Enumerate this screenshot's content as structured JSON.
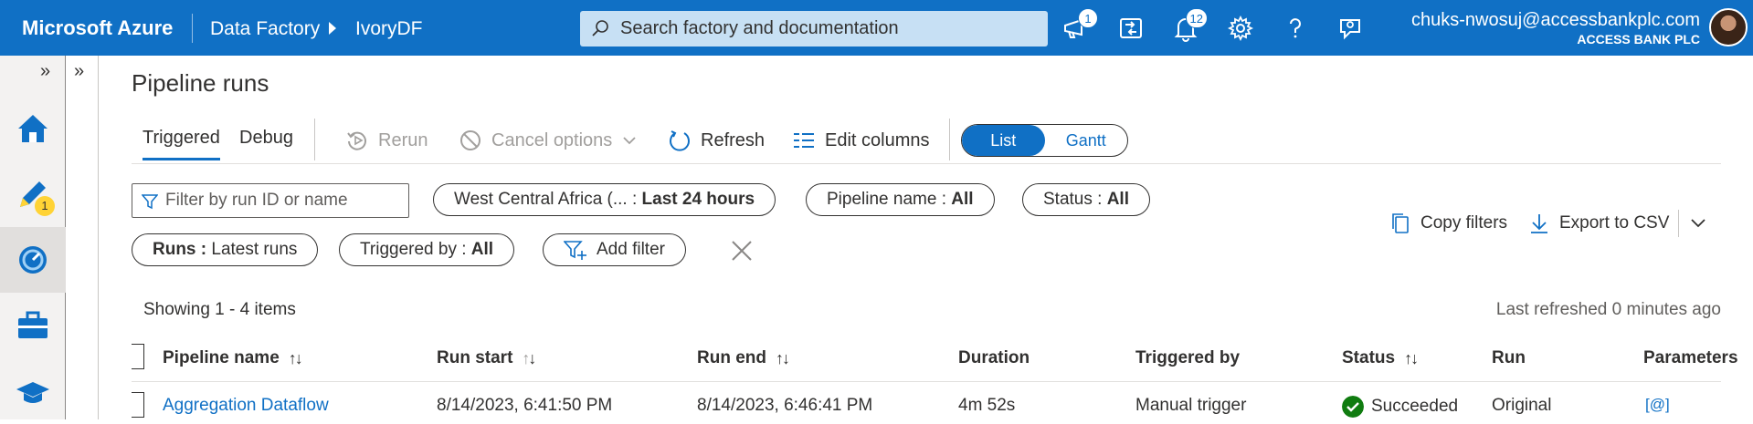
{
  "topbar": {
    "brand": "Microsoft Azure",
    "breadcrumb": [
      "Data Factory",
      "IvoryDF"
    ],
    "search_placeholder": "Search factory and documentation",
    "notifications_updates": "1",
    "notifications_bell": "12",
    "account_email": "chuks-nwosuj@accessbankplc.com",
    "account_org": "ACCESS BANK PLC"
  },
  "rail": {
    "author_badge": "1",
    "items": [
      "home-icon",
      "pencil-author-icon",
      "monitor-gauge-icon",
      "toolbox-icon",
      "graduation-cap-icon"
    ]
  },
  "page": {
    "title": "Pipeline runs",
    "tabs": [
      "Triggered",
      "Debug"
    ],
    "commands": {
      "rerun": "Rerun",
      "cancel": "Cancel options",
      "refresh": "Refresh",
      "edit_columns": "Edit columns"
    },
    "view_toggle": [
      "List",
      "Gantt"
    ]
  },
  "filters": {
    "search_placeholder": "Filter by run ID or name",
    "region_label": "West Central Africa (...",
    "region_value": "Last 24 hours",
    "pipeline_label": "Pipeline name : ",
    "pipeline_value": "All",
    "status_label": "Status : ",
    "status_value": "All",
    "runs_label": "Runs : ",
    "runs_value": "Latest runs",
    "triggered_label": "Triggered by : ",
    "triggered_value": "All",
    "add_filter": "Add filter",
    "copy_filters": "Copy filters",
    "export_csv": "Export to CSV"
  },
  "table": {
    "showing": "Showing 1 - 4 items",
    "last_refreshed": "Last refreshed 0 minutes ago",
    "columns": [
      "Pipeline name",
      "Run start",
      "Run end",
      "Duration",
      "Triggered by",
      "Status",
      "Run",
      "Parameters"
    ],
    "rows": [
      {
        "pipeline_name": "Aggregation Dataflow",
        "run_start": "8/14/2023, 6:41:50 PM",
        "run_end": "8/14/2023, 6:46:41 PM",
        "duration": "4m 52s",
        "triggered_by": "Manual trigger",
        "status": "Succeeded",
        "run": "Original",
        "parameters": "[@]"
      }
    ]
  },
  "colors": {
    "accent": "#1070c5",
    "success": "#107c10"
  }
}
